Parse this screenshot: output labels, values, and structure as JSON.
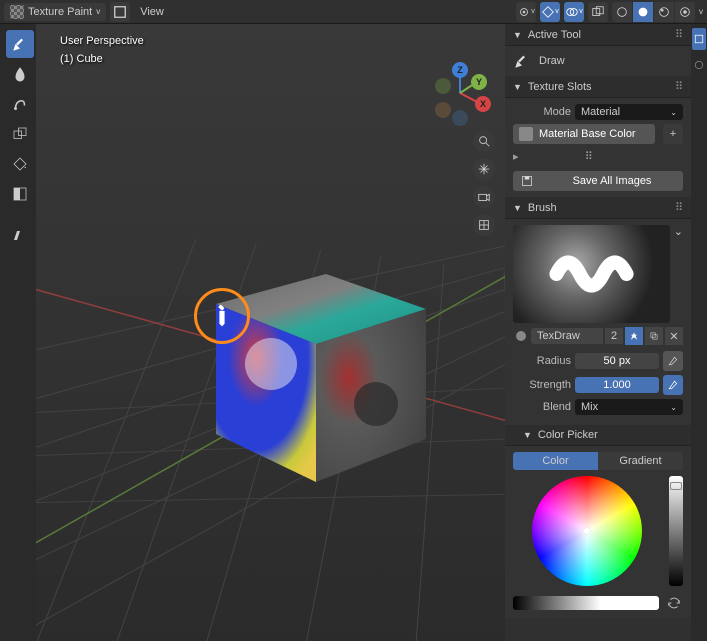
{
  "topbar": {
    "mode": "Texture Paint",
    "menus": [
      "View"
    ]
  },
  "viewport": {
    "overlay_line1": "User Perspective",
    "overlay_line2": "(1) Cube"
  },
  "gizmo": {
    "x": "X",
    "y": "Y",
    "z": "Z"
  },
  "panels": {
    "active_tool": {
      "title": "Active Tool",
      "tool": "Draw"
    },
    "texture_slots": {
      "title": "Texture Slots",
      "mode_label": "Mode",
      "mode_value": "Material",
      "slot_name": "Material Base Color",
      "save_btn": "Save All Images"
    },
    "brush": {
      "title": "Brush",
      "name": "TexDraw",
      "count": "2",
      "radius_label": "Radius",
      "radius_value": "50 px",
      "strength_label": "Strength",
      "strength_value": "1.000",
      "blend_label": "Blend",
      "blend_value": "Mix"
    },
    "color_picker": {
      "title": "Color Picker",
      "tab_color": "Color",
      "tab_gradient": "Gradient"
    }
  }
}
